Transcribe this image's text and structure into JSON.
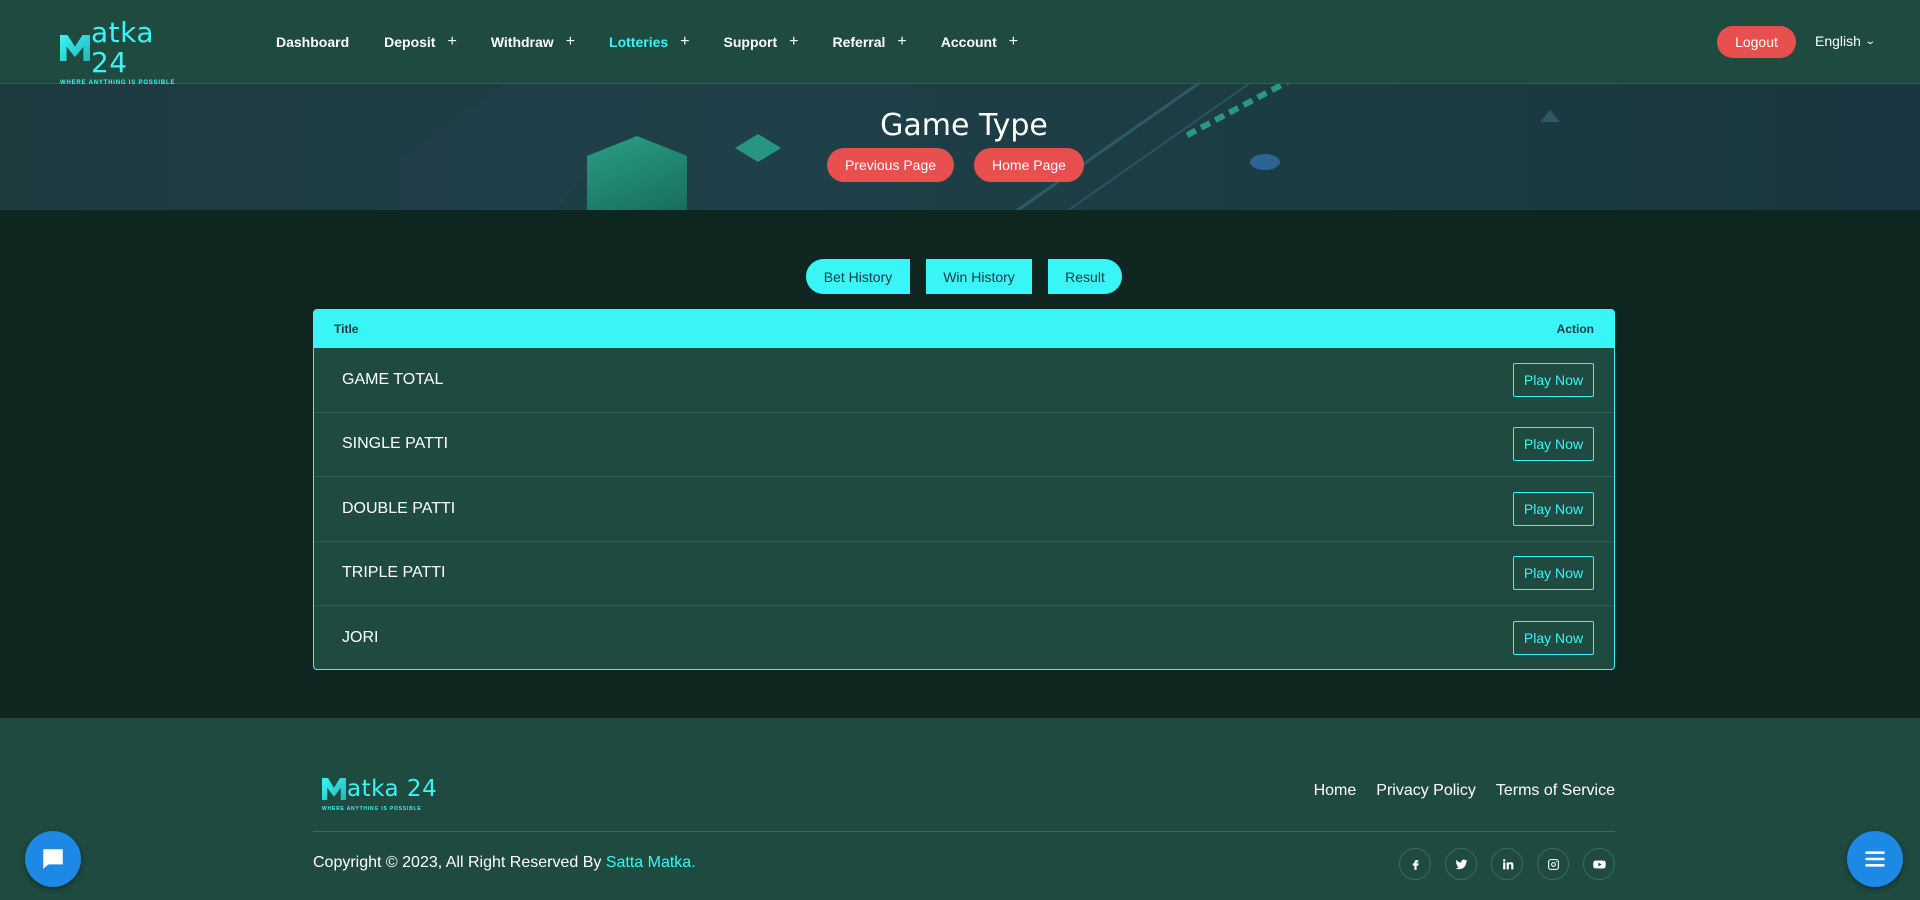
{
  "brand": {
    "logo_text": "atka 24",
    "logo_tagline": "WHERE ANYTHING IS POSSIBLE"
  },
  "nav": {
    "items": [
      {
        "label": "Dashboard",
        "has_plus": false,
        "active": false
      },
      {
        "label": "Deposit",
        "has_plus": true,
        "active": false
      },
      {
        "label": "Withdraw",
        "has_plus": true,
        "active": false
      },
      {
        "label": "Lotteries",
        "has_plus": true,
        "active": true
      },
      {
        "label": "Support",
        "has_plus": true,
        "active": false
      },
      {
        "label": "Referral",
        "has_plus": true,
        "active": false
      },
      {
        "label": "Account",
        "has_plus": true,
        "active": false
      }
    ],
    "plus_icon": "+",
    "logout_label": "Logout",
    "language": "English"
  },
  "banner": {
    "title": "Game Type",
    "prev_label": "Previous Page",
    "home_label": "Home Page"
  },
  "tabs": {
    "bet_history": "Bet History",
    "win_history": "Win History",
    "result": "Result"
  },
  "table": {
    "col_title": "Title",
    "col_action": "Action",
    "rows": [
      {
        "title": "GAME TOTAL",
        "action": "Play Now"
      },
      {
        "title": "SINGLE PATTI",
        "action": "Play Now"
      },
      {
        "title": "DOUBLE PATTI",
        "action": "Play Now"
      },
      {
        "title": "TRIPLE PATTI",
        "action": "Play Now"
      },
      {
        "title": "JORI",
        "action": "Play Now"
      }
    ]
  },
  "footer": {
    "links": [
      "Home",
      "Privacy Policy",
      "Terms of Service"
    ],
    "copyright_prefix": "Copyright © 2023, All Right Reserved By ",
    "copyright_brand": "Satta Matka.",
    "socials": [
      "facebook-icon",
      "twitter-icon",
      "linkedin-icon",
      "instagram-icon",
      "youtube-icon"
    ]
  },
  "colors": {
    "accent": "#3af5f5",
    "danger": "#e8504f",
    "header_bg": "#1f4a40",
    "body_bg": "#0f2520",
    "float_btn": "#1e88e5"
  }
}
